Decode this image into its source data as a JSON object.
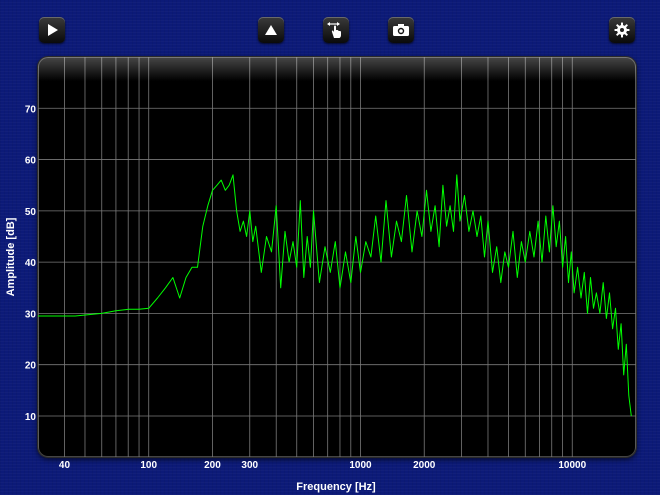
{
  "toolbar": {
    "buttons": [
      {
        "name": "play-button",
        "icon": "play-icon"
      },
      {
        "name": "up-button",
        "icon": "triangle-up-icon"
      },
      {
        "name": "pan-button",
        "icon": "hand-pointer-icon"
      },
      {
        "name": "camera-button",
        "icon": "camera-icon"
      },
      {
        "name": "settings-button",
        "icon": "gear-icon"
      }
    ]
  },
  "colors": {
    "background": "#0c1a78",
    "plot_background": "#000000",
    "grid": "#7a7a7a",
    "trace": "#00ff00",
    "label": "#ffffff"
  },
  "chart_data": {
    "type": "line",
    "title": "",
    "xlabel": "Frequency [Hz]",
    "ylabel": "Amplitude [dB]",
    "x_scale": "log",
    "xlim": [
      30,
      20000
    ],
    "ylim": [
      2,
      80
    ],
    "x_ticks": [
      40,
      100,
      200,
      300,
      1000,
      2000,
      10000
    ],
    "x_tick_labels": [
      "40",
      "100",
      "200",
      "300",
      "1000",
      "2000",
      "10000"
    ],
    "y_ticks": [
      10,
      20,
      30,
      40,
      50,
      60,
      70
    ],
    "y_tick_labels": [
      "10",
      "20",
      "30",
      "40",
      "50",
      "60",
      "70"
    ],
    "grid": true,
    "legend": "none",
    "series": [
      {
        "values_x": [
          30,
          45,
          60,
          70,
          80,
          90,
          100,
          110,
          120,
          130,
          140,
          150,
          160,
          170,
          180,
          190,
          200,
          210,
          220,
          230,
          240,
          250,
          260,
          270,
          280,
          290,
          300,
          310,
          320,
          340,
          360,
          380,
          400,
          420,
          440,
          460,
          480,
          500,
          520,
          540,
          560,
          580,
          600,
          640,
          680,
          720,
          760,
          800,
          850,
          900,
          950,
          1000,
          1060,
          1120,
          1180,
          1250,
          1320,
          1400,
          1480,
          1560,
          1650,
          1750,
          1850,
          1950,
          2050,
          2150,
          2250,
          2350,
          2450,
          2550,
          2650,
          2750,
          2850,
          2950,
          3100,
          3250,
          3400,
          3550,
          3700,
          3850,
          4000,
          4200,
          4400,
          4600,
          4800,
          5000,
          5250,
          5500,
          5750,
          6000,
          6300,
          6600,
          6900,
          7200,
          7500,
          7800,
          8100,
          8400,
          8700,
          9000,
          9300,
          9600,
          9900,
          10200,
          10600,
          11000,
          11400,
          11800,
          12200,
          12600,
          13000,
          13500,
          14000,
          14500,
          15000,
          15500,
          16000,
          16500,
          17000,
          17500,
          18000,
          18500,
          19000,
          19500,
          20000
        ],
        "values": [
          29.5,
          29.5,
          30,
          30.5,
          30.8,
          30.8,
          31,
          33,
          35,
          37,
          33,
          37,
          39,
          39,
          47,
          51,
          54,
          55,
          56,
          54,
          55,
          57,
          50,
          46,
          48,
          45,
          50,
          44,
          47,
          38,
          45,
          42,
          51,
          35,
          46,
          40,
          44,
          39,
          52,
          37,
          45,
          39,
          50,
          36,
          43,
          38,
          44,
          35,
          42,
          36,
          45,
          38,
          44,
          41,
          49,
          40,
          52,
          41,
          48,
          44,
          53,
          42,
          50,
          45,
          54,
          46,
          51,
          43,
          55,
          47,
          51,
          46,
          57,
          48,
          53,
          46,
          50,
          45,
          49,
          41,
          48,
          38,
          43,
          36,
          42,
          39,
          46,
          37,
          44,
          40,
          46,
          41,
          48,
          40,
          49,
          42,
          51,
          43,
          48,
          39,
          45,
          36,
          42,
          34,
          39,
          33,
          38,
          30,
          37,
          31,
          34,
          30,
          36,
          29,
          34,
          27,
          31,
          23,
          28,
          18,
          24,
          14,
          10
        ]
      }
    ]
  }
}
